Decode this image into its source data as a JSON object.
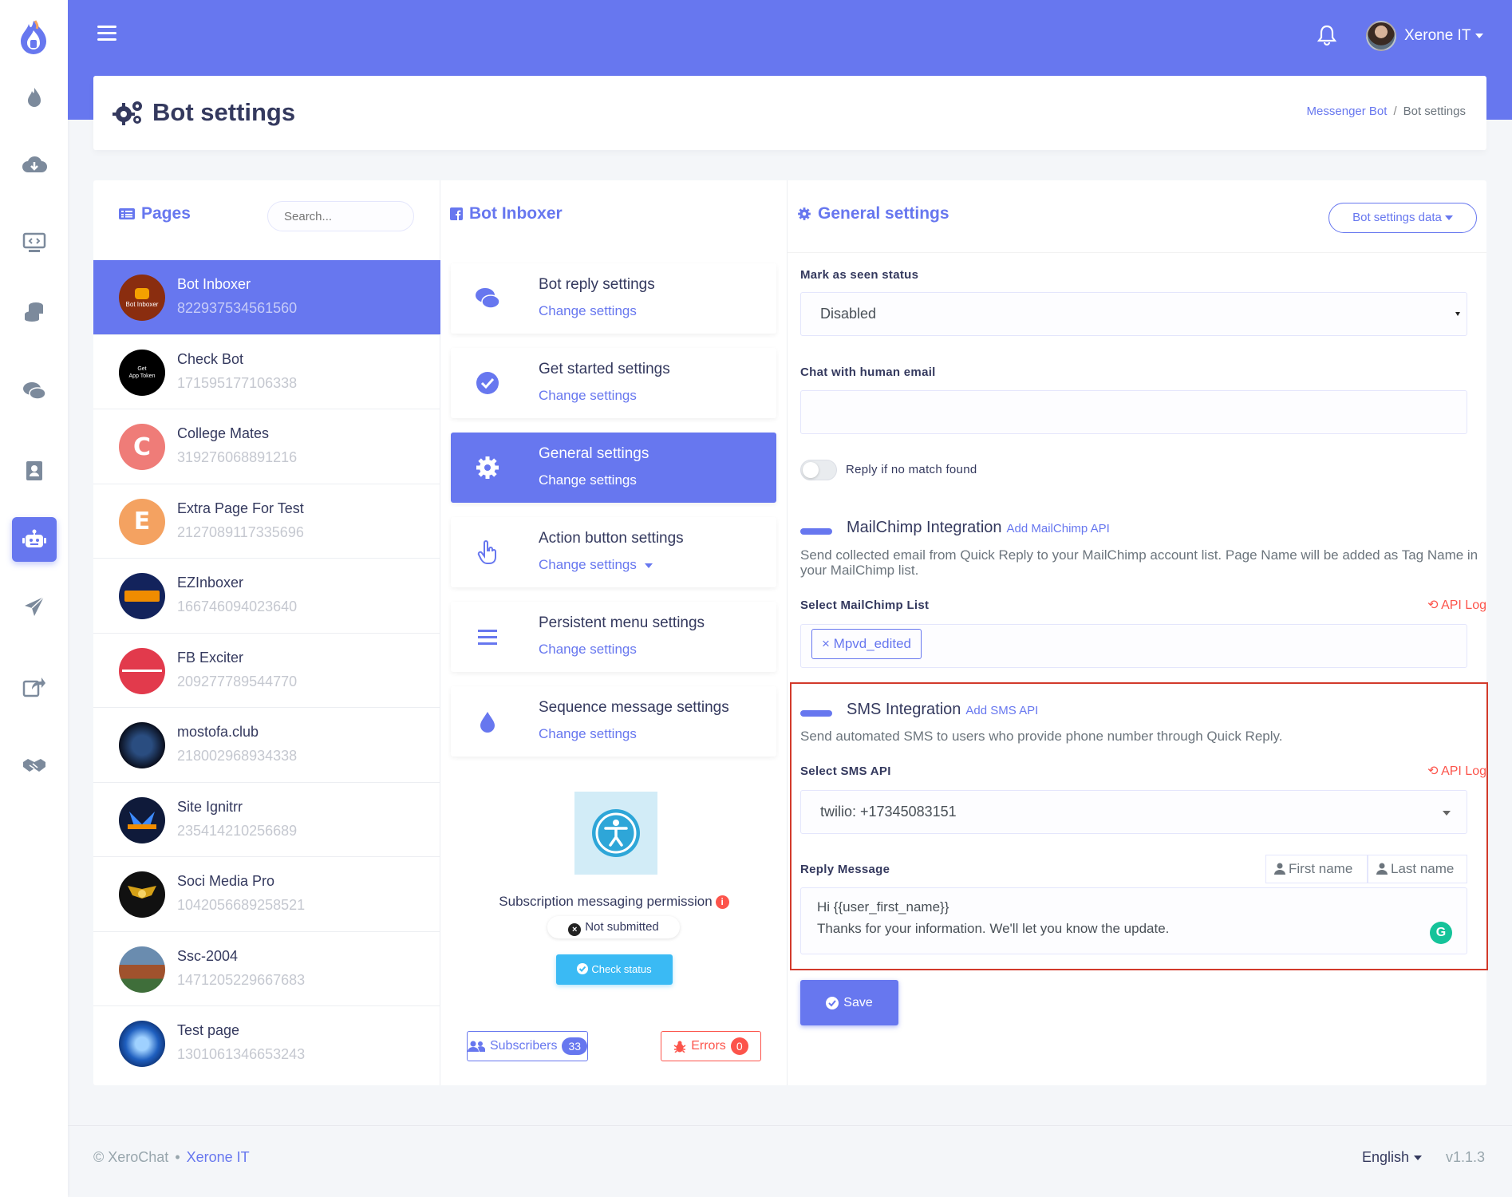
{
  "header": {
    "user_name": "Xerone IT",
    "page_title": "Bot settings",
    "breadcrumb": [
      "Messenger Bot",
      "Bot settings"
    ]
  },
  "pages_panel": {
    "title": "Pages",
    "search_placeholder": "Search...",
    "items": [
      {
        "name": "Bot Inboxer",
        "id": "822937534561560",
        "avatar_text": "",
        "active": true
      },
      {
        "name": "Check Bot",
        "id": "171595177106338",
        "avatar_text": ""
      },
      {
        "name": "College Mates",
        "id": "319276068891216",
        "avatar_text": "C",
        "color": "#ef7c78"
      },
      {
        "name": "Extra Page For Test",
        "id": "2127089117335696",
        "avatar_text": "E",
        "color": "#f4a261"
      },
      {
        "name": "EZInboxer",
        "id": "166746094023640",
        "avatar_text": ""
      },
      {
        "name": "FB Exciter",
        "id": "209277789544770",
        "avatar_text": ""
      },
      {
        "name": "mostofa.club",
        "id": "218002968934338",
        "avatar_text": ""
      },
      {
        "name": "Site Ignitrr",
        "id": "235414210256689",
        "avatar_text": ""
      },
      {
        "name": "Soci Media Pro",
        "id": "1042056689258521",
        "avatar_text": ""
      },
      {
        "name": "Ssc-2004",
        "id": "1471205229667683",
        "avatar_text": ""
      },
      {
        "name": "Test page",
        "id": "1301061346653243",
        "avatar_text": ""
      }
    ]
  },
  "bot_panel": {
    "title": "Bot Inboxer",
    "settings": [
      {
        "title": "Bot reply settings",
        "link": "Change settings",
        "icon": "comments-icon"
      },
      {
        "title": "Get started settings",
        "link": "Change settings",
        "icon": "check-circle-icon"
      },
      {
        "title": "General settings",
        "link": "Change settings",
        "icon": "gear-icon",
        "active": true
      },
      {
        "title": "Action button settings",
        "link": "Change settings",
        "icon": "hand-pointer-icon"
      },
      {
        "title": "Persistent menu settings",
        "link": "Change settings",
        "icon": "menu-lines-icon"
      },
      {
        "title": "Sequence message settings",
        "link": "Change settings",
        "icon": "droplet-icon"
      }
    ],
    "subscription_text": "Subscription messaging permission",
    "not_submitted": "Not submitted",
    "check_status": "Check status",
    "subscribers_label": "Subscribers",
    "subscribers_count": "33",
    "errors_label": "Errors",
    "errors_count": "0"
  },
  "general": {
    "title": "General settings",
    "data_button": "Bot settings data",
    "mark_seen_label": "Mark as seen status",
    "mark_seen_value": "Disabled",
    "human_email_label": "Chat with human email",
    "human_email_value": "",
    "reply_no_match_label": "Reply if no match found",
    "mailchimp": {
      "title": "MailChimp Integration",
      "link": "Add MailChimp API",
      "desc": "Send collected email from Quick Reply to your MailChimp account list. Page Name will be added as Tag Name in your MailChimp list.",
      "select_label": "Select MailChimp List",
      "api_log": "API Log",
      "tag": "Mpvd_edited"
    },
    "sms": {
      "title": "SMS Integration",
      "link": "Add SMS API",
      "desc": "Send automated SMS to users who provide phone number through Quick Reply.",
      "select_label": "Select SMS API",
      "api_log": "API Log",
      "selected": "twilio: +17345083151",
      "reply_label": "Reply Message",
      "first_name_btn": "First name",
      "last_name_btn": "Last name",
      "message_line1": "Hi {{user_first_name}}",
      "message_line2": "Thanks for your information. We'll let you know the update."
    },
    "save": "Save"
  },
  "footer": {
    "copyright": "© XeroChat",
    "company": "Xerone IT",
    "language": "English",
    "version": "v1.1.3"
  }
}
